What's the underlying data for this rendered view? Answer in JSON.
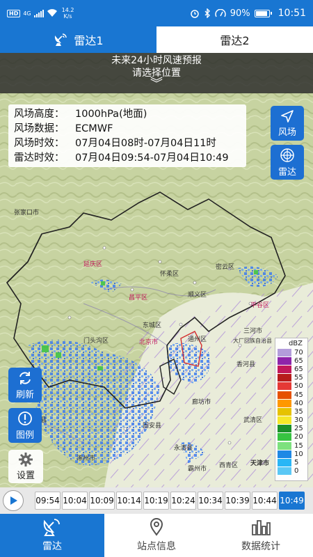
{
  "status_bar": {
    "hd": "HD",
    "signal": "4G",
    "net_speed_value": "14.2",
    "net_speed_unit": "K/s",
    "battery": "90%",
    "time": "10:51"
  },
  "top_tabs": [
    {
      "label": "雷达1",
      "icon": "radar-dish-icon",
      "active": true
    },
    {
      "label": "雷达2",
      "active": false
    }
  ],
  "forecast_banner": {
    "title": "未来24小时风速预报",
    "subtitle": "请选择位置",
    "chevron": "︾"
  },
  "info_box": {
    "rows": [
      {
        "key": "风场高度：",
        "value": "1000hPa(地面)"
      },
      {
        "key": "风场数据：",
        "value": "ECMWF"
      },
      {
        "key": "风场时效：",
        "value": "07月04日08时-07月04日11时"
      },
      {
        "key": "雷达时效：",
        "value": "07月04日09:54-07月04日10:49"
      }
    ]
  },
  "side_buttons": {
    "wind": "风场",
    "radar": "雷达",
    "refresh": "刷新",
    "legend": "图例",
    "settings": "设置"
  },
  "legend": {
    "unit": "dBZ",
    "levels": [
      {
        "value": "70",
        "color": "#b39ddb"
      },
      {
        "value": "65",
        "color": "#8e24aa"
      },
      {
        "value": "65",
        "color": "#c2185b"
      },
      {
        "value": "55",
        "color": "#b71c1c"
      },
      {
        "value": "50",
        "color": "#e53935"
      },
      {
        "value": "45",
        "color": "#e65100"
      },
      {
        "value": "40",
        "color": "#ff9800"
      },
      {
        "value": "35",
        "color": "#e6c200"
      },
      {
        "value": "30",
        "color": "#f5e829"
      },
      {
        "value": "25",
        "color": "#1b8f2a"
      },
      {
        "value": "20",
        "color": "#37c341"
      },
      {
        "value": "15",
        "color": "#7de17e"
      },
      {
        "value": "10",
        "color": "#1e88e5"
      },
      {
        "value": "5",
        "color": "#29b6f6"
      },
      {
        "value": "0",
        "color": "#5bc8f5"
      }
    ]
  },
  "map_labels": [
    {
      "text": "延庆区"
    },
    {
      "text": "怀柔区"
    },
    {
      "text": "密云区"
    },
    {
      "text": "昌平区"
    },
    {
      "text": "顺义区"
    },
    {
      "text": "平谷区"
    },
    {
      "text": "通州区"
    },
    {
      "text": "三河市"
    },
    {
      "text": "大厂回族自治县"
    },
    {
      "text": "香河县"
    },
    {
      "text": "廊坊市"
    },
    {
      "text": "天津市"
    },
    {
      "text": "永清县"
    },
    {
      "text": "霸州市"
    },
    {
      "text": "武清区"
    },
    {
      "text": "固安县"
    },
    {
      "text": "涿州市"
    },
    {
      "text": "北京市"
    },
    {
      "text": "门头沟区"
    },
    {
      "text": "张家口市"
    },
    {
      "text": "涞水县"
    },
    {
      "text": "东城区"
    },
    {
      "text": "西青区"
    }
  ],
  "timeline": {
    "times": [
      "09:54",
      "10:04",
      "10:09",
      "10:14",
      "10:19",
      "10:24",
      "10:34",
      "10:39",
      "10:44",
      "10:49"
    ],
    "active_index": 9
  },
  "bottom_nav": [
    {
      "label": "雷达",
      "icon": "radar-dish-icon",
      "active": true
    },
    {
      "label": "站点信息",
      "icon": "location-pin-icon",
      "active": false
    },
    {
      "label": "数据统计",
      "icon": "bar-chart-icon",
      "active": false
    }
  ]
}
